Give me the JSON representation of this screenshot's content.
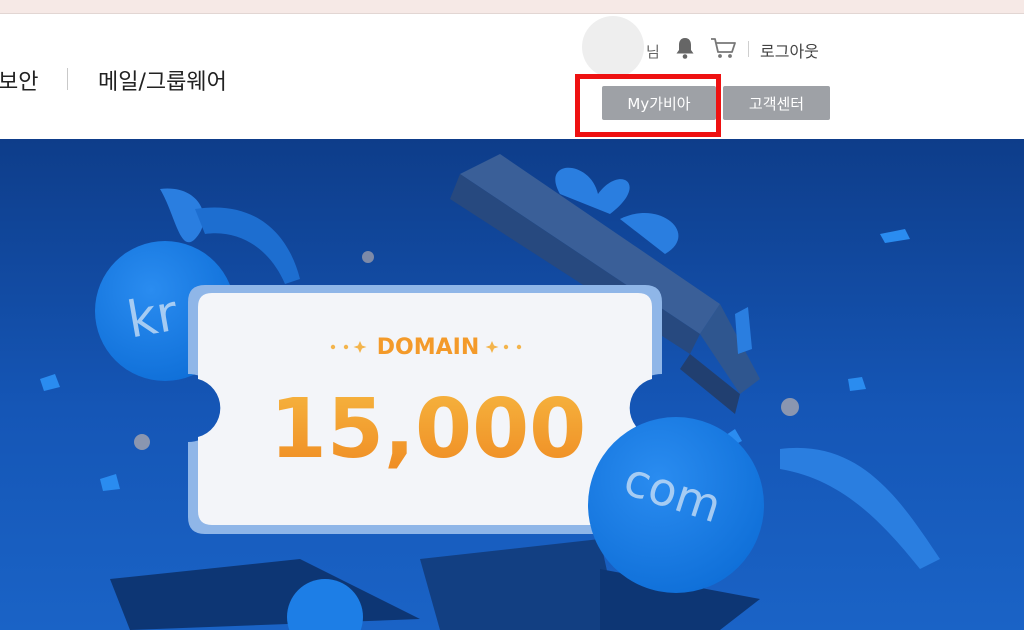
{
  "header": {
    "nav_items": [
      "보안",
      "메일/그룹웨어"
    ],
    "user_suffix": "님",
    "logout": "로그아웃",
    "my_button": "My가비아",
    "support_button": "고객센터",
    "highlight_color": "#ee1111"
  },
  "banner": {
    "coupon_label": "DOMAIN",
    "coupon_amount": "15,000",
    "bubble_kr": "kr",
    "bubble_com": "com",
    "accent_color": "#f39a2a",
    "background_color": "#1556b6"
  },
  "icons": {
    "bell": "bell-icon",
    "cart": "cart-icon"
  }
}
